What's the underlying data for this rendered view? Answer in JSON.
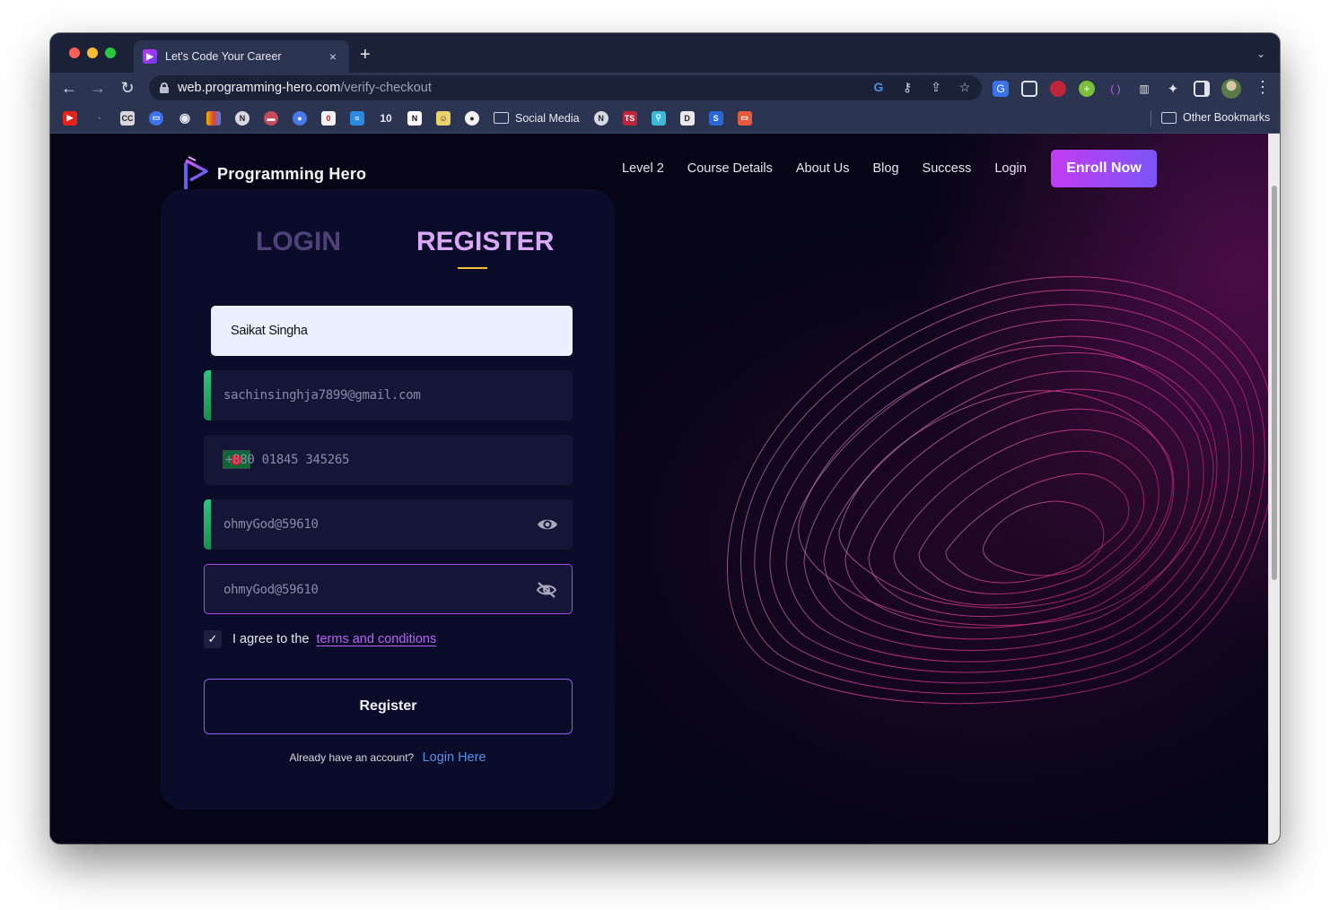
{
  "browser": {
    "tab_title": "Let's Code Your Career",
    "tab_close": "×",
    "new_tab": "+",
    "tab_search": "⌄",
    "url_host": "web.programming-hero.com",
    "url_path": "/verify-checkout",
    "back": "←",
    "forward": "→",
    "reload": "↻",
    "menu": "⋮",
    "omni_icons": [
      "G",
      "⚷",
      "⇪",
      "☆"
    ],
    "bookmark_folder": "Social Media",
    "other_bookmarks": "Other Bookmarks"
  },
  "site": {
    "logo_text": "Programming Hero",
    "nav": [
      "Level 2",
      "Course Details",
      "About Us",
      "Blog",
      "Success",
      "Login"
    ],
    "enroll": "Enroll Now"
  },
  "form": {
    "tab_login": "LOGIN",
    "tab_register": "REGISTER",
    "name_value": "Saikat Singha",
    "email_value": "sachinsinghja7899@gmail.com",
    "phone_value": "+880 01845 345265",
    "password_value": "ohmyGod@59610",
    "confirm_value": "ohmyGod@59610",
    "checkbox_mark": "✓",
    "agree_text": "I agree to the",
    "terms_link": "terms and conditions",
    "register_button": "Register",
    "already_text": "Already have an account?",
    "login_here": "Login Here"
  },
  "colors": {
    "accent_gradient_start": "#c33cf2",
    "accent_gradient_end": "#7b55f7",
    "field_bar": "#2fc37e",
    "underline": "#f3c13e",
    "terms_link": "#b765f2",
    "login_link": "#5a8ee8"
  }
}
